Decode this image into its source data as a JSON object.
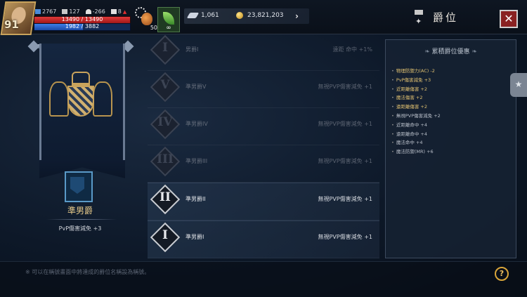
{
  "hud": {
    "level": "91",
    "stat1": "2767",
    "stat2": "127",
    "stat3": "-266",
    "stat4": "8",
    "hp_text": "13490 / 13490",
    "hp_fraction": 1.0,
    "mp_text": "1982 / 3882",
    "mp_fraction": 0.51,
    "potion_count": "50",
    "buff_label": "∞",
    "diamonds": "1,061",
    "gold": "23,821,203",
    "arrow": "›"
  },
  "header": {
    "title": "爵位",
    "close": "✕",
    "title_icon_glyph": "✦"
  },
  "current_rank": {
    "name": "準男爵",
    "bonus": "PvP傷害減免 +3"
  },
  "ranks": [
    {
      "numeral": "I",
      "name": "男爵I",
      "effect": "命中 +1%",
      "effect_prefix": "遠距",
      "active": false
    },
    {
      "numeral": "V",
      "name": "準男爵V",
      "effect": "無視PVP傷害減免 +1",
      "active": false
    },
    {
      "numeral": "IV",
      "name": "準男爵IV",
      "effect": "無視PVP傷害減免 +1",
      "active": false
    },
    {
      "numeral": "III",
      "name": "準男爵III",
      "effect": "無視PVP傷害減免 +1",
      "active": false
    },
    {
      "numeral": "II",
      "name": "準男爵II",
      "effect": "無視PVP傷害減免 +1",
      "active": true
    },
    {
      "numeral": "I",
      "name": "準男爵I",
      "effect": "無視PVP傷害減免 +1",
      "active": true
    }
  ],
  "panel": {
    "title": "累積爵位優惠",
    "items": [
      {
        "text": "物理防禦力(AC) -2",
        "color": "#e0c070"
      },
      {
        "text": "PvP傷害減免 +3",
        "color": "#e0c070"
      },
      {
        "text": "近距離傷害 +2",
        "color": "#e0c070"
      },
      {
        "text": "魔法傷害 +2",
        "color": "#e0c070"
      },
      {
        "text": "遠距離傷害 +2",
        "color": "#e0c070"
      },
      {
        "text": "無視PVP傷害減免 +2",
        "color": "#b8bec8"
      },
      {
        "text": "近距離命中 +4",
        "color": "#b8bec8"
      },
      {
        "text": "遠距離命中 +4",
        "color": "#b8bec8"
      },
      {
        "text": "魔法命中 +4",
        "color": "#b8bec8"
      },
      {
        "text": "魔法防禦(MR) +6",
        "color": "#b8bec8"
      }
    ]
  },
  "footer": {
    "hint": "※ 可以在稱號畫面中將達成的爵位名稱設為稱號。",
    "help": "?"
  },
  "side_tab": "★"
}
